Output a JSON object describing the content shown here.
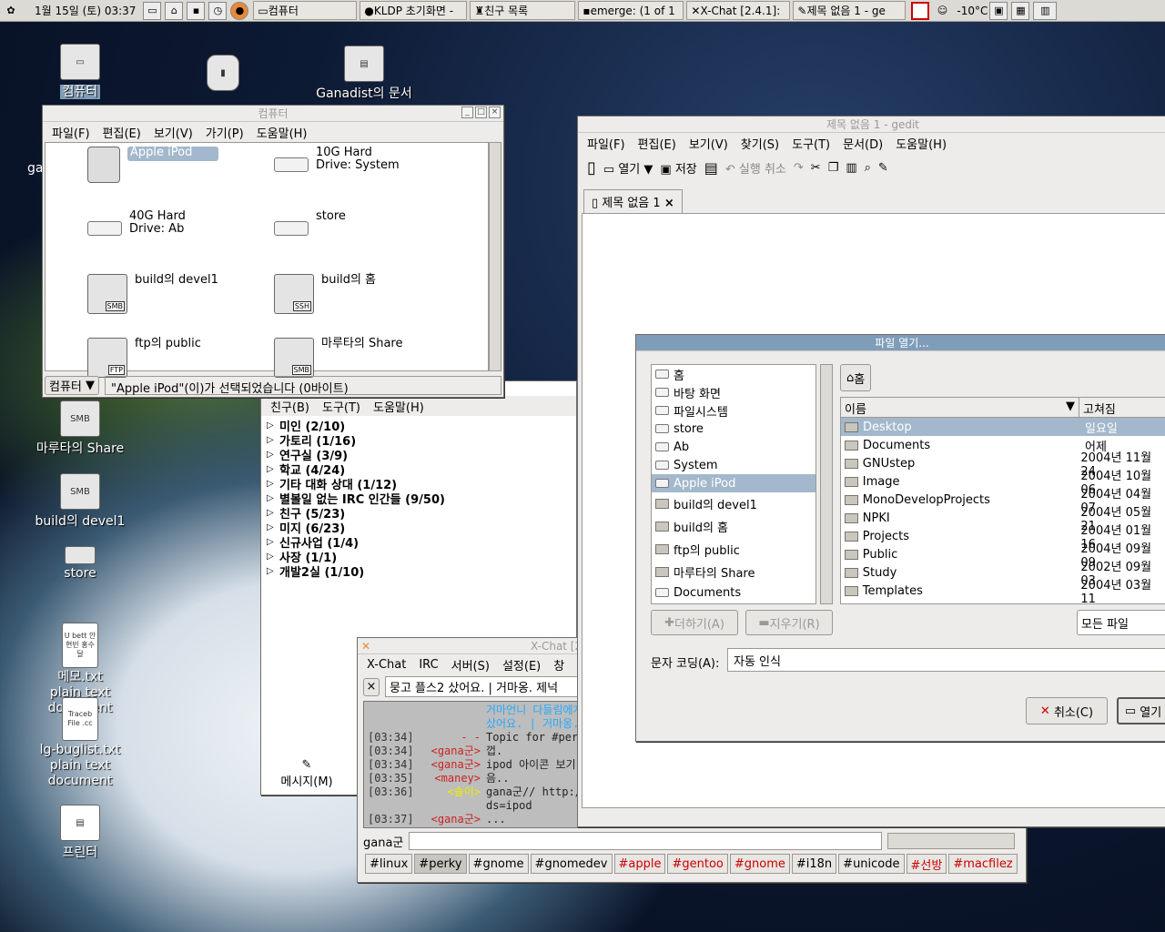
{
  "panel": {
    "clock": "1월 15일 (토) 03:37",
    "tasks": [
      "컴퓨터",
      "KLDP 초기화면 -",
      "친구 목록",
      "emerge: (1 of 1",
      "X-Chat [2.4.1]:",
      "제목 없음 1 - ge"
    ],
    "temp": "-10°C"
  },
  "desktop": {
    "icons": [
      "컴퓨터",
      "Ganadist의 문서",
      "마루타의 Share",
      "build의 devel1",
      "store",
      "메모.txt",
      "plain text",
      "document",
      "lg-buglist.txt",
      "plain text",
      "document",
      "프린터"
    ],
    "memo_icon_text": "U bett 안현빈 홍수달",
    "bug_icon_text": "Traceb File .cc",
    "share_badge": "SMB",
    "devel_badge": "SMB",
    "ga_left": "ga"
  },
  "computer": {
    "title": "컴퓨터",
    "menu": [
      "파일(F)",
      "편집(E)",
      "보기(V)",
      "가기(P)",
      "도움말(H)"
    ],
    "items": [
      {
        "label": "Apple iPod",
        "kind": "ipod"
      },
      {
        "label": "10G Hard Drive: System",
        "kind": "drive"
      },
      {
        "label": "40G Hard Drive: Ab",
        "kind": "drive"
      },
      {
        "label": "store",
        "kind": "drive"
      },
      {
        "label": "build의 devel1",
        "kind": "smb",
        "badge": "SMB"
      },
      {
        "label": "build의 홈",
        "kind": "smb",
        "badge": "SSH"
      },
      {
        "label": "ftp의 public",
        "kind": "smb",
        "badge": "FTP"
      },
      {
        "label": "마루타의 Share",
        "kind": "smb",
        "badge": "SMB"
      }
    ],
    "location": "컴퓨터",
    "status": "\"Apple iPod\"(이)가 선택되었습니다 (0바이트)"
  },
  "buddy": {
    "menu": [
      "친구(B)",
      "도구(T)",
      "도움말(H)"
    ],
    "groups": [
      "미인 (2/10)",
      "가토리 (1/16)",
      "연구실 (3/9)",
      "학교 (4/24)",
      "기타 대화 상대 (1/12)",
      "별볼일 없는 IRC 인간들 (9/50)",
      "친구 (5/23)",
      "미지 (6/23)",
      "신규사업 (1/4)",
      "사장 (1/1)",
      "개발2실 (1/10)"
    ],
    "message_btn": "메시지(M)"
  },
  "xchat": {
    "title": "X-Chat [2.4.",
    "menu": [
      "X-Chat",
      "IRC",
      "서버(S)",
      "설정(E)",
      "창"
    ],
    "topic": "뭉고 플스2 샀어요. | 거마옹. 제넉",
    "lines": [
      {
        "t": "",
        "n": "",
        "m": "거마언니 다들림에게"
      },
      {
        "t": "",
        "n": "",
        "m": "샀어요. | 거마옹."
      },
      {
        "t": "[03:34]",
        "n": "- -",
        "m": "Topic for #perk"
      },
      {
        "t": "[03:34]",
        "n": "<gana군>",
        "m": "껍."
      },
      {
        "t": "[03:34]",
        "n": "<gana군>",
        "m": "ipod 아이콘 보기"
      },
      {
        "t": "[03:35]",
        "n": "<maney>",
        "m": "음.."
      },
      {
        "t": "[03:36]",
        "n": "<솔이>",
        "m": "gana군// http://"
      },
      {
        "t": "",
        "n": "",
        "m": "ds=ipod"
      },
      {
        "t": "[03:37]",
        "n": "<gana군>",
        "m": "..."
      }
    ],
    "nick": "gana군",
    "channels": [
      {
        "name": "#linux",
        "hl": false
      },
      {
        "name": "#perky",
        "hl": false
      },
      {
        "name": "#gnome",
        "hl": false
      },
      {
        "name": "#gnomedev",
        "hl": false
      },
      {
        "name": "#apple",
        "hl": true
      },
      {
        "name": "#gentoo",
        "hl": true
      },
      {
        "name": "#gnome",
        "hl": true
      },
      {
        "name": "#i18n",
        "hl": false
      },
      {
        "name": "#unicode",
        "hl": false
      },
      {
        "name": "#선방",
        "hl": true
      },
      {
        "name": "#macfilez",
        "hl": true
      }
    ]
  },
  "gedit": {
    "title": "제목 없음 1 - gedit",
    "menu": [
      "파일(F)",
      "편집(E)",
      "보기(V)",
      "찾기(S)",
      "도구(T)",
      "문서(D)",
      "도움말(H)"
    ],
    "open_label": "열기",
    "save_label": "저장",
    "undo_label": "실행 취소",
    "tab": "제목 없음 1"
  },
  "dialog": {
    "title": "파일 열기...",
    "places": [
      {
        "label": "홈",
        "kind": "home"
      },
      {
        "label": "바탕 화면",
        "kind": "desk"
      },
      {
        "label": "파일시스템",
        "kind": "drive"
      },
      {
        "label": "store",
        "kind": "drive"
      },
      {
        "label": "Ab",
        "kind": "drive"
      },
      {
        "label": "System",
        "kind": "drive"
      },
      {
        "label": "Apple iPod",
        "kind": "ipod"
      },
      {
        "label": "build의 devel1",
        "kind": "net"
      },
      {
        "label": "build의 홈",
        "kind": "net"
      },
      {
        "label": "ftp의 public",
        "kind": "net"
      },
      {
        "label": "마루타의 Share",
        "kind": "net"
      },
      {
        "label": "Documents",
        "kind": "drive"
      }
    ],
    "path_btn": "홈",
    "col_name": "이름",
    "col_mod": "고쳐짐",
    "files": [
      {
        "name": "Desktop",
        "date": "일요일"
      },
      {
        "name": "Documents",
        "date": "어제"
      },
      {
        "name": "GNUstep",
        "date": "2004년 11월 24"
      },
      {
        "name": "Image",
        "date": "2004년 10월 06"
      },
      {
        "name": "MonoDevelopProjects",
        "date": "2004년 04월 07"
      },
      {
        "name": "NPKI",
        "date": "2004년 05월 21"
      },
      {
        "name": "Projects",
        "date": "2004년 01월 16"
      },
      {
        "name": "Public",
        "date": "2004년 09월 09"
      },
      {
        "name": "Study",
        "date": "2002년 09월 03"
      },
      {
        "name": "Templates",
        "date": "2004년 03월 11"
      }
    ],
    "add_btn": "더하기(A)",
    "remove_btn": "지우기(R)",
    "filter": "모든 파일",
    "encoding_label": "문자 코딩(A):",
    "encoding_value": "자동 인식",
    "cancel_btn": "취소(C)",
    "open_btn": "열기"
  }
}
